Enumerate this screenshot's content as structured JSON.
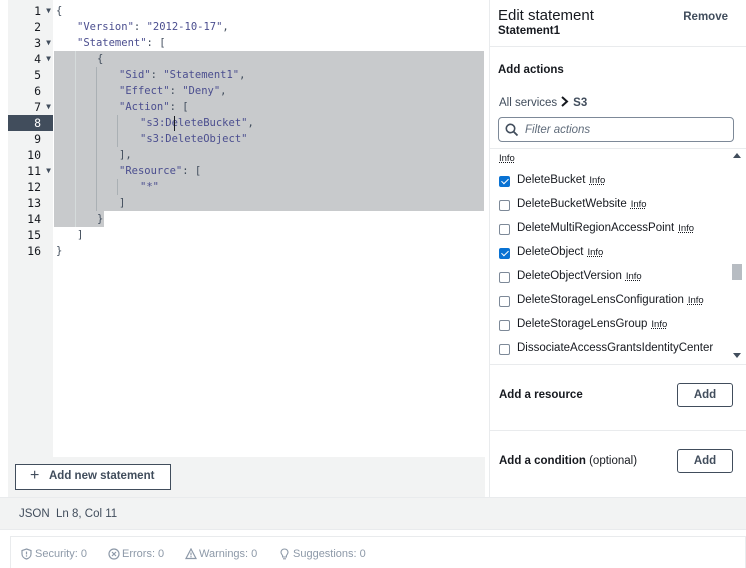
{
  "editor": {
    "lines": [
      {
        "num": "1",
        "fold": true
      },
      {
        "num": "2",
        "fold": false
      },
      {
        "num": "3",
        "fold": true
      },
      {
        "num": "4",
        "fold": true
      },
      {
        "num": "5",
        "fold": false
      },
      {
        "num": "6",
        "fold": false
      },
      {
        "num": "7",
        "fold": true
      },
      {
        "num": "8",
        "fold": false
      },
      {
        "num": "9",
        "fold": false
      },
      {
        "num": "10",
        "fold": false
      },
      {
        "num": "11",
        "fold": true
      },
      {
        "num": "12",
        "fold": false
      },
      {
        "num": "13",
        "fold": false
      },
      {
        "num": "14",
        "fold": false
      },
      {
        "num": "15",
        "fold": false
      },
      {
        "num": "16",
        "fold": false
      }
    ],
    "active_line": "8",
    "code": {
      "l1": "{",
      "l2_key": "\"Version\"",
      "l2_rest": ": ",
      "l2_val": "\"2012-10-17\"",
      "l2_end": ",",
      "l3_key": "\"Statement\"",
      "l3_rest": ": [",
      "l4": "{",
      "l5_key": "\"Sid\"",
      "l5_rest": ": ",
      "l5_val": "\"Statement1\"",
      "l5_end": ",",
      "l6_key": "\"Effect\"",
      "l6_rest": ": ",
      "l6_val": "\"Deny\"",
      "l6_end": ",",
      "l7_key": "\"Action\"",
      "l7_rest": ": [",
      "l8_val": "\"s3:DeleteBucket\"",
      "l8_end": ",",
      "l9_val": "\"s3:DeleteObject\"",
      "l10": "],",
      "l11_key": "\"Resource\"",
      "l11_rest": ": [",
      "l12_val": "\"*\"",
      "l13": "]",
      "l14": "}",
      "l15": "]",
      "l16": "}"
    },
    "add_statement_label": "Add new statement"
  },
  "panel": {
    "title": "Edit statement",
    "subtitle": "Statement1",
    "remove_label": "Remove",
    "add_actions_label": "Add actions",
    "breadcrumb_all": "All services",
    "breadcrumb_service": "S3",
    "search_placeholder": "Filter actions",
    "info_label": "Info",
    "actions": [
      {
        "name": "DeleteBucket",
        "checked": true
      },
      {
        "name": "DeleteBucketWebsite",
        "checked": false
      },
      {
        "name": "DeleteMultiRegionAccessPoint",
        "checked": false
      },
      {
        "name": "DeleteObject",
        "checked": true
      },
      {
        "name": "DeleteObjectVersion",
        "checked": false
      },
      {
        "name": "DeleteStorageLensConfiguration",
        "checked": false
      },
      {
        "name": "DeleteStorageLensGroup",
        "checked": false
      },
      {
        "name": "DissociateAccessGrantsIdentityCenter",
        "checked": false
      }
    ],
    "add_resource_label": "Add a resource",
    "add_condition_label": "Add a condition",
    "add_condition_optional": "(optional)",
    "add_button_label": "Add"
  },
  "status": {
    "mode": "JSON",
    "position": "Ln 8, Col 11"
  },
  "diagnostics": {
    "security": "Security: 0",
    "errors": "Errors: 0",
    "warnings": "Warnings: 0",
    "suggestions": "Suggestions: 0"
  },
  "colors": {
    "selection": "#c8cacc",
    "checkbox_checked": "#0972d3",
    "gutter_active": "#414d5c"
  }
}
